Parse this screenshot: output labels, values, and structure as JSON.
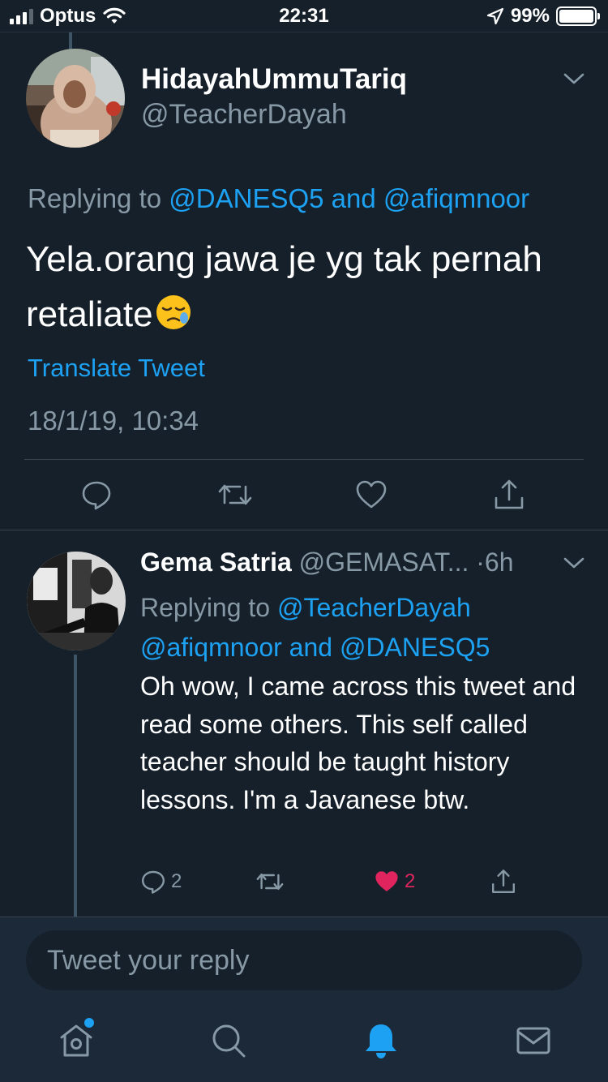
{
  "status_bar": {
    "carrier": "Optus",
    "time": "22:31",
    "battery_percent": "99%",
    "battery_level": 0.99,
    "signal_bars_filled": 3,
    "signal_bars_total": 4
  },
  "colors": {
    "background": "#15202b",
    "accent": "#1da1f2",
    "secondary_text": "#8899a6",
    "like": "#e0245e"
  },
  "main_tweet": {
    "display_name": "HidayahUmmuTariq",
    "handle": "@TeacherDayah",
    "replying_prefix": "Replying to",
    "replying_user_1": "@DANESQ5",
    "replying_and": "and",
    "replying_user_2": "@afiqmnoor",
    "text": "Yela.orang jawa je yg tak pernah retaliate",
    "emoji": "sleepy-face-emoji",
    "translate_label": "Translate Tweet",
    "timestamp": "18/1/19, 10:34",
    "actions": [
      "reply-icon",
      "retweet-icon",
      "like-icon",
      "share-icon"
    ]
  },
  "reply_tweet": {
    "display_name": "Gema Satria",
    "handle": "@GEMASAT...",
    "time": "·6h",
    "replying_prefix": "Replying to",
    "replying_user_1": "@TeacherDayah",
    "replying_user_2": "@afiqmnoor",
    "replying_and": "and",
    "replying_user_3": "@DANESQ5",
    "text": "Oh wow, I came across this tweet and read some others. This self called teacher should be taught history lessons. I'm a Javanese btw.",
    "reply_count": "2",
    "like_count": "2",
    "liked": true
  },
  "composer": {
    "placeholder": "Tweet your reply"
  },
  "tab_bar": {
    "tabs": [
      "home-icon",
      "search-icon",
      "notifications-icon",
      "messages-icon"
    ],
    "active": "notifications-icon"
  }
}
